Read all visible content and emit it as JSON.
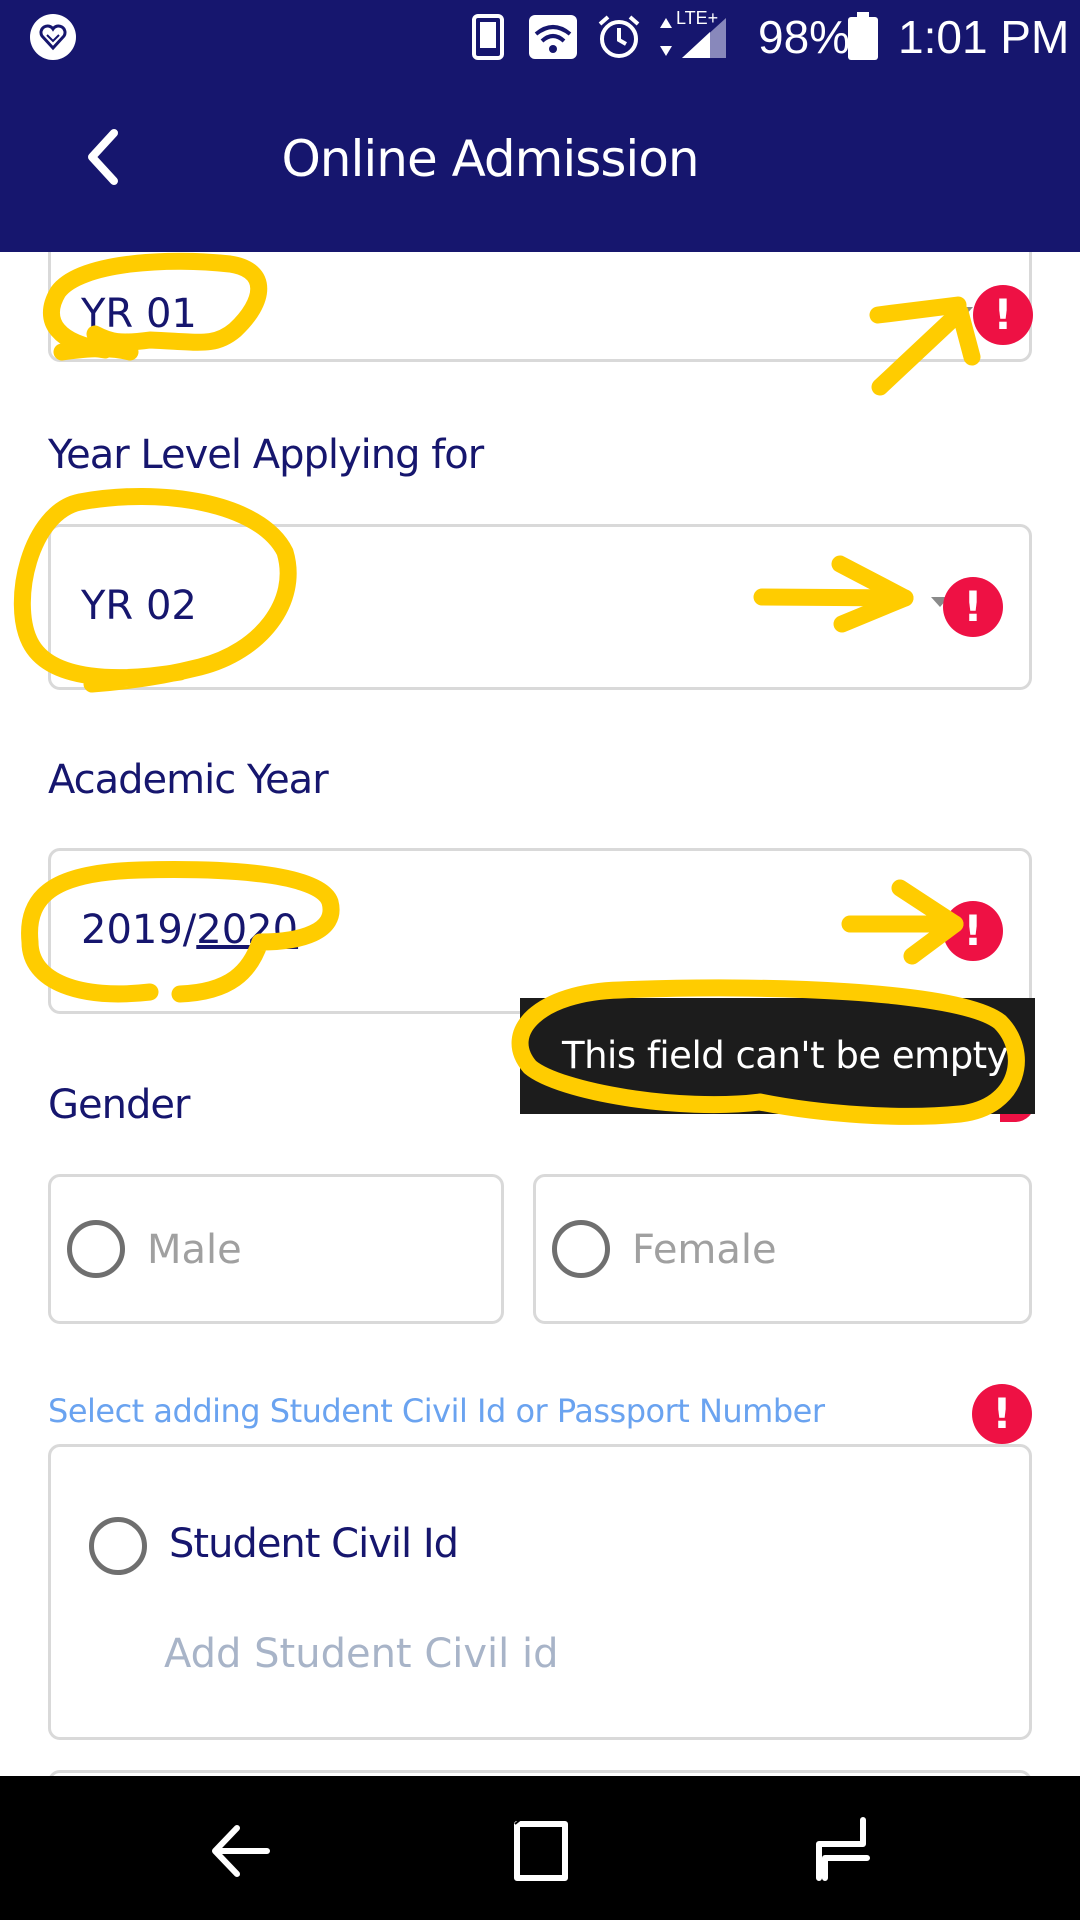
{
  "status_bar": {
    "battery": "98%",
    "time": "1:01 PM",
    "network_label": "LTE+"
  },
  "app_bar": {
    "title": "Online Admission"
  },
  "form": {
    "previous_field_value": "YR 01",
    "year_level_label": "Year Level Applying for",
    "year_level_value": "YR 02",
    "academic_year_label": "Academic Year",
    "academic_year_value_prefix": "2019/",
    "academic_year_value_suffix": "2020",
    "gender_label": "Gender",
    "gender_options": [
      "Male",
      "Female"
    ],
    "id_hint": "Select adding Student Civil Id or Passport Number",
    "civil_id_option": "Student Civil Id",
    "civil_id_placeholder": "Add Student Civil id",
    "error_tooltip": "This field can't be empty"
  },
  "colors": {
    "primary": "#16166e",
    "error": "#ee1144",
    "hint": "#6aa3f0",
    "highlight": "#ffcc00"
  },
  "icons": {
    "back": "back-arrow-icon",
    "error": "error-exclamation-icon",
    "nav_back": "nav-back-icon",
    "nav_home": "nav-home-icon",
    "nav_recents": "nav-recents-icon"
  }
}
